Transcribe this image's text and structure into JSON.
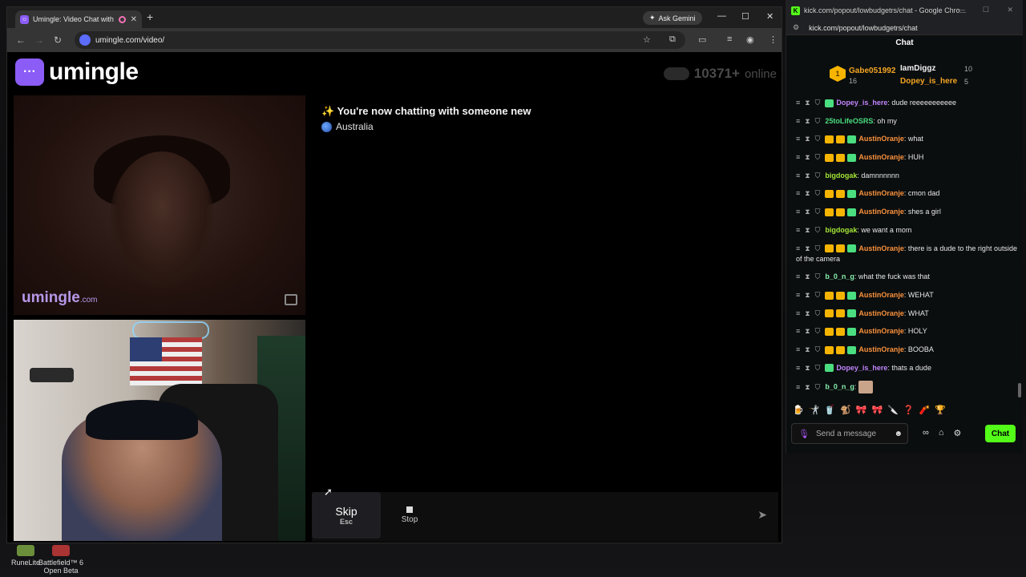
{
  "desktop": {
    "icons": [
      {
        "label": "RuneLite",
        "icon": "runelite-icon"
      },
      {
        "label": "Battlefield™ 6 Open Beta",
        "icon": "battlefield-icon"
      }
    ]
  },
  "browser": {
    "tab_title": "Umingle: Video Chat with S",
    "new_tab": "+",
    "ask_gemini": "Ask Gemini",
    "url": "umingle.com/video/"
  },
  "umingle": {
    "logo_text": "umingle",
    "online_count": "10371+",
    "online_label": "online",
    "watermark_main": "umingle",
    "watermark_suffix": ".com",
    "system_message": "✨ You're now chatting with someone new",
    "country": "Australia",
    "skip_label": "Skip",
    "skip_shortcut": "Esc",
    "stop_label": "Stop"
  },
  "kick": {
    "window_title": "kick.com/popout/lowbudgetrs/chat - Google Chro...",
    "url": "kick.com/popout/lowbudgetrs/chat",
    "header": "Chat",
    "leaderboard": {
      "top": {
        "rank": "1",
        "name": "Gabe051992",
        "score": "16"
      },
      "second": {
        "name": "IamDiggz",
        "score": "10"
      },
      "third": {
        "name": "Dopey_is_here",
        "score": "5"
      }
    },
    "messages": [
      {
        "user": "Dopey_is_here",
        "color": "#c084fc",
        "text": ": dude reeeeeeeeeee",
        "badges": [
          "#4ade80"
        ]
      },
      {
        "user": "25toLifeOSRS",
        "color": "#4ade80",
        "text": ": oh my",
        "badges": []
      },
      {
        "user": "AustinOranje",
        "color": "#fb923c",
        "text": ": what",
        "badges": [
          "#f5b400",
          "#f5b400",
          "#4ade80"
        ]
      },
      {
        "user": "AustinOranje",
        "color": "#fb923c",
        "text": ": HUH",
        "badges": [
          "#f5b400",
          "#f5b400",
          "#4ade80"
        ]
      },
      {
        "user": "bigdogak",
        "color": "#a3e635",
        "text": ": damnnnnnn",
        "badges": []
      },
      {
        "user": "AustinOranje",
        "color": "#fb923c",
        "text": ": cmon dad",
        "badges": [
          "#f5b400",
          "#f5b400",
          "#4ade80"
        ]
      },
      {
        "user": "AustinOranje",
        "color": "#fb923c",
        "text": ": shes a girl",
        "badges": [
          "#f5b400",
          "#f5b400",
          "#4ade80"
        ]
      },
      {
        "user": "bigdogak",
        "color": "#a3e635",
        "text": ": we want a mom",
        "badges": []
      },
      {
        "user": "AustinOranje",
        "color": "#fb923c",
        "text": ": there is a dude to the right outside of the camera",
        "badges": [
          "#f5b400",
          "#f5b400",
          "#4ade80"
        ]
      },
      {
        "user": "b_0_n_g",
        "color": "#86efac",
        "text": ": what the fuck was that",
        "badges": []
      },
      {
        "user": "AustinOranje",
        "color": "#fb923c",
        "text": ": WEHAT",
        "badges": [
          "#f5b400",
          "#f5b400",
          "#4ade80"
        ]
      },
      {
        "user": "AustinOranje",
        "color": "#fb923c",
        "text": ": WHAT",
        "badges": [
          "#f5b400",
          "#f5b400",
          "#4ade80"
        ]
      },
      {
        "user": "AustinOranje",
        "color": "#fb923c",
        "text": ": HOLY",
        "badges": [
          "#f5b400",
          "#f5b400",
          "#4ade80"
        ]
      },
      {
        "user": "AustinOranje",
        "color": "#fb923c",
        "text": ": BOOBA",
        "badges": [
          "#f5b400",
          "#f5b400",
          "#4ade80"
        ]
      },
      {
        "user": "Dopey_is_here",
        "color": "#c084fc",
        "text": ": thats a dude",
        "badges": [
          "#4ade80"
        ]
      },
      {
        "user": "b_0_n_g",
        "color": "#86efac",
        "text": ": ",
        "badges": [],
        "emote": true
      }
    ],
    "input_placeholder": "Send a message",
    "chat_button": "Chat",
    "accent": "#53fc18"
  }
}
